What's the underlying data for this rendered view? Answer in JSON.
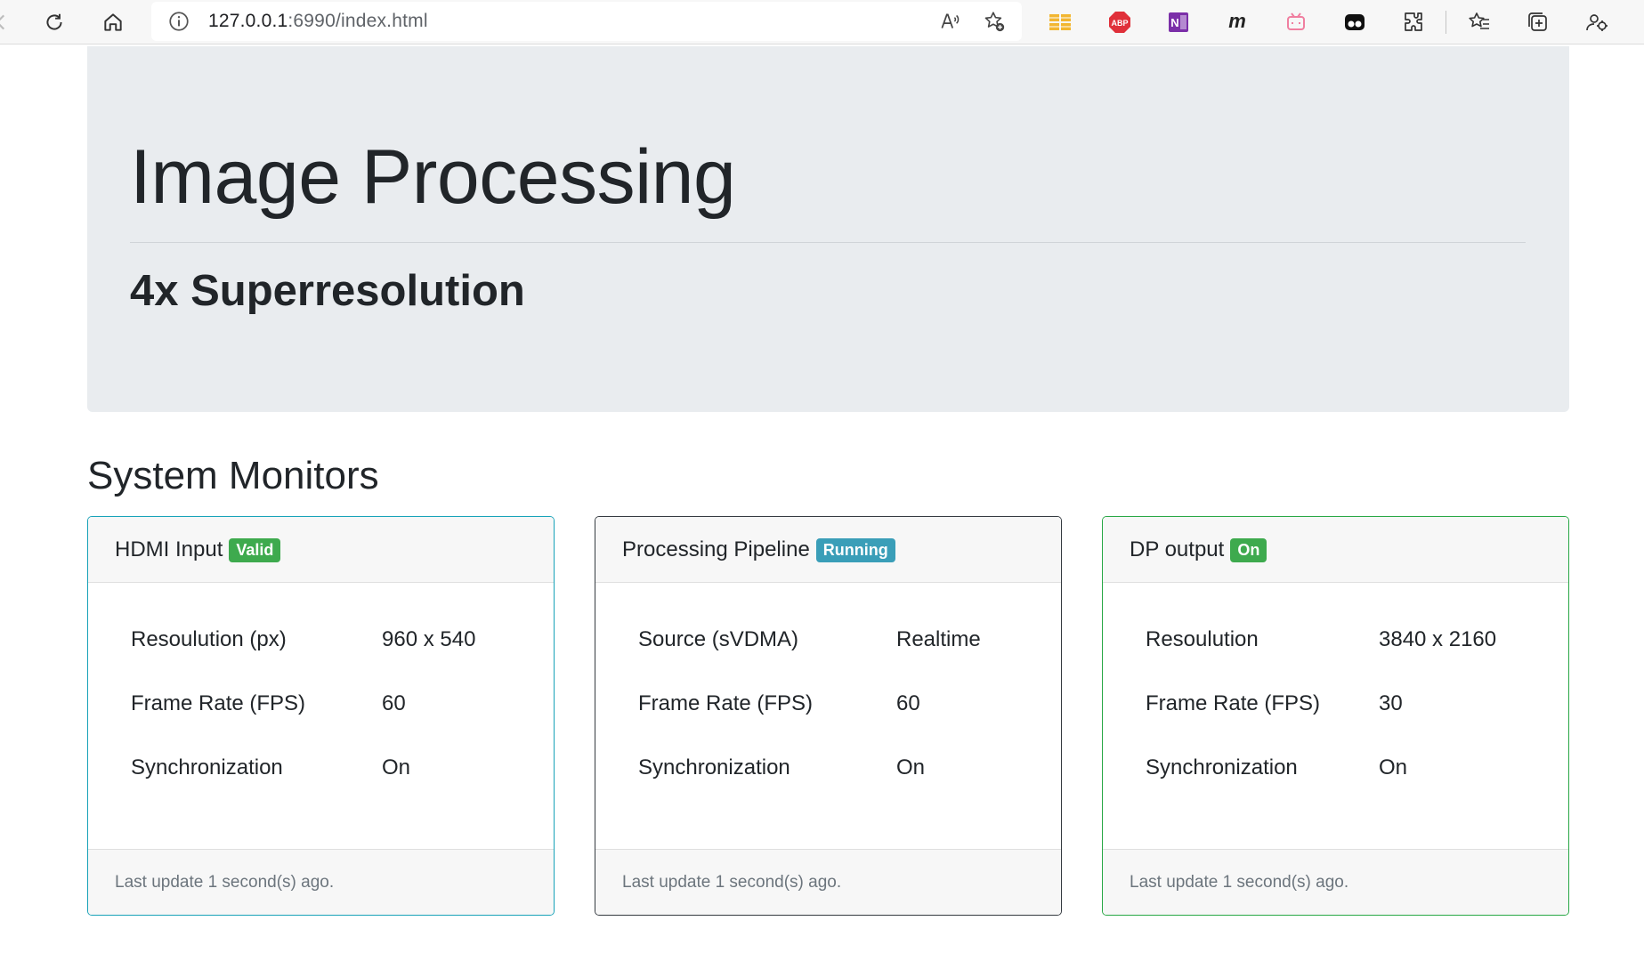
{
  "browser": {
    "url_host": "127.0.0.1",
    "url_rest": ":6990/index.html",
    "icons": [
      "back-icon",
      "refresh-icon",
      "home-icon",
      "site-info-icon",
      "read-aloud-icon",
      "add-favorite-icon",
      "extension-grid-icon",
      "adblock-plus-icon",
      "onenote-icon",
      "m-extension-icon",
      "bilibili-icon",
      "dark-mask-icon",
      "extensions-icon",
      "favorites-icon",
      "collections-icon",
      "profile-icon"
    ],
    "adblock_label": "ABP",
    "onenote_label": "N",
    "m_label": "m"
  },
  "jumbotron": {
    "title": "Image Processing",
    "subtitle": "4x Superresolution"
  },
  "section": {
    "title": "System Monitors"
  },
  "cards": [
    {
      "title": "HDMI Input",
      "badge": "Valid",
      "badge_color": "#3eaa4e",
      "border_color": "#17a2b8",
      "rows": [
        {
          "key": "Resoulution (px)",
          "value": "960 x 540"
        },
        {
          "key": "Frame Rate (FPS)",
          "value": "60"
        },
        {
          "key": "Synchronization",
          "value": "On"
        }
      ],
      "footer": "Last update 1 second(s) ago."
    },
    {
      "title": "Processing Pipeline",
      "badge": "Running",
      "badge_color": "#3a9eb8",
      "border_color": "#343a40",
      "rows": [
        {
          "key": "Source (sVDMA)",
          "value": "Realtime"
        },
        {
          "key": "Frame Rate (FPS)",
          "value": "60"
        },
        {
          "key": "Synchronization",
          "value": "On"
        }
      ],
      "footer": "Last update 1 second(s) ago."
    },
    {
      "title": "DP output",
      "badge": "On",
      "badge_color": "#3eaa4e",
      "border_color": "#28a745",
      "rows": [
        {
          "key": "Resoulution",
          "value": "3840 x 2160"
        },
        {
          "key": "Frame Rate (FPS)",
          "value": "30"
        },
        {
          "key": "Synchronization",
          "value": "On"
        }
      ],
      "footer": "Last update 1 second(s) ago."
    }
  ]
}
